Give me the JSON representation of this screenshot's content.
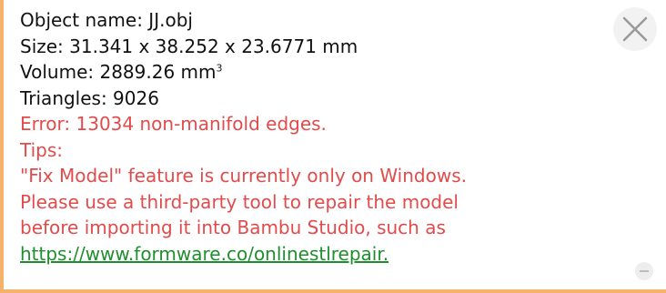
{
  "info": {
    "object_name": "Object name: JJ.obj",
    "size": "Size: 31.341 x 38.252 x 23.6771 mm",
    "volume_prefix": "Volume: 2889.26 mm",
    "volume_unit_sup": "3",
    "triangles": "Triangles: 9026"
  },
  "error": {
    "message": "Error: 13034 non-manifold edges.",
    "tips_label": "Tips:",
    "tip_lines": [
      "\"Fix Model\" feature is currently only on Windows.",
      "Please use a third-party tool to repair the model",
      "before importing it into Bambu Studio, such as"
    ],
    "link_text": "https://www.formware.co/onlinestlrepair."
  },
  "icons": {
    "close": "close-icon",
    "collapse": "minus-icon"
  },
  "colors": {
    "accent_border": "#F6B26B",
    "error": "#E14B4B",
    "link": "#1F8F2E"
  }
}
